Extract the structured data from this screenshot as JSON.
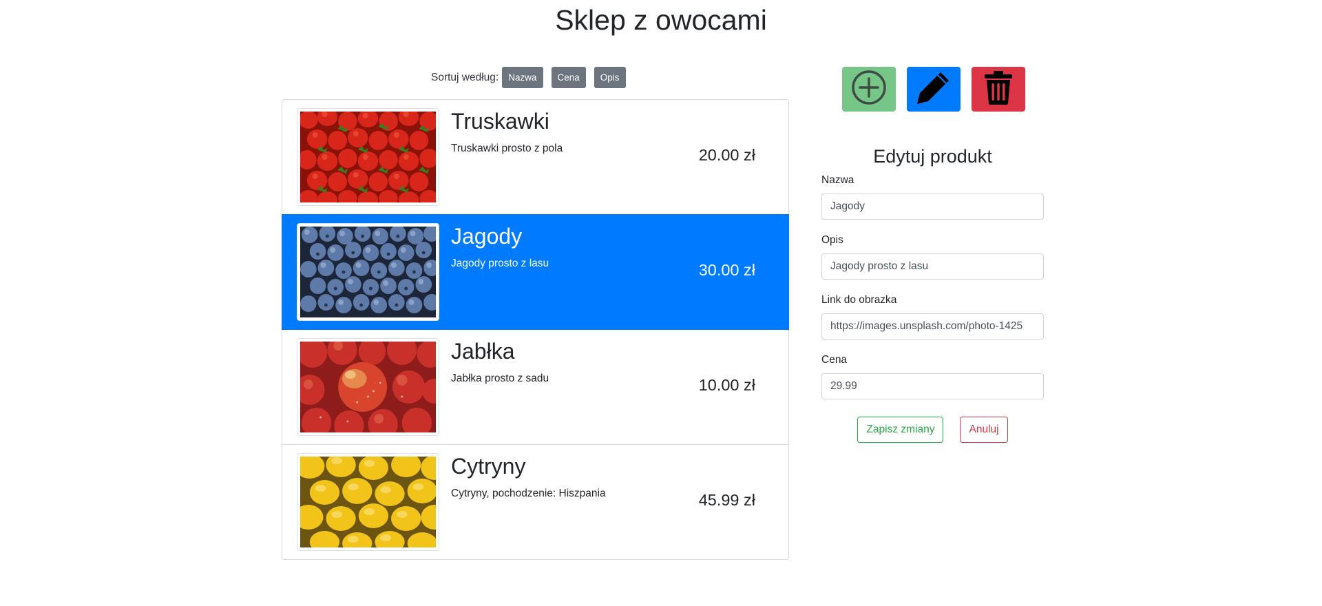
{
  "page": {
    "title": "Sklep z owocami"
  },
  "sort": {
    "label": "Sortuj według:",
    "buttons": [
      "Nazwa",
      "Cena",
      "Opis"
    ]
  },
  "products": [
    {
      "name": "Truskawki",
      "description": "Truskawki prosto z pola",
      "price": "20.00 zł",
      "image": "strawberries-photo",
      "active": false
    },
    {
      "name": "Jagody",
      "description": "Jagody prosto z lasu",
      "price": "30.00 zł",
      "image": "blueberries-photo",
      "active": true
    },
    {
      "name": "Jabłka",
      "description": "Jabłka prosto z sadu",
      "price": "10.00 zł",
      "image": "apples-photo",
      "active": false
    },
    {
      "name": "Cytryny",
      "description": "Cytryny, pochodzenie: Hiszpania",
      "price": "45.99 zł",
      "image": "lemons-photo",
      "active": false
    }
  ],
  "actions": {
    "add_icon": "plus-circle-icon",
    "edit_icon": "pencil-icon",
    "delete_icon": "trash-icon"
  },
  "form": {
    "title": "Edytuj produkt",
    "fields": [
      {
        "label": "Nazwa",
        "value": "Jagody"
      },
      {
        "label": "Opis",
        "value": "Jagody prosto z lasu"
      },
      {
        "label": "Link do obrazka",
        "value": "https://images.unsplash.com/photo-1425"
      },
      {
        "label": "Cena",
        "value": "29.99"
      }
    ],
    "save_label": "Zapisz zmiany",
    "cancel_label": "Anuluj"
  },
  "colors": {
    "primary": "#007bff",
    "secondary": "#6c757d",
    "success": "#28a745",
    "danger": "#dc3545",
    "add_button": "#75c687"
  }
}
